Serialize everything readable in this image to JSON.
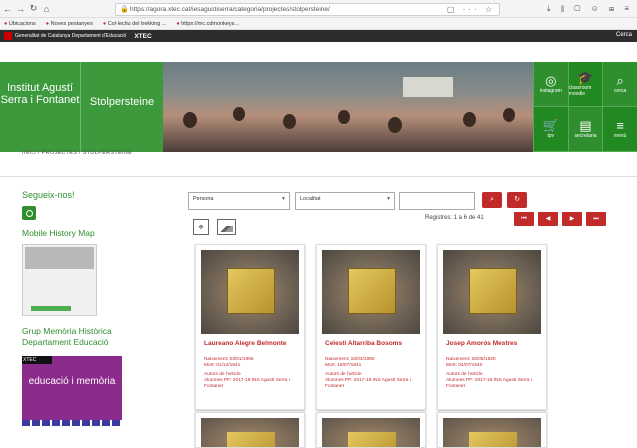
{
  "browser": {
    "url": "https://agora.xtec.cat/iesagustiserra/categoria/projectes/stolpersteine/",
    "bookmarks": [
      "Ubicacions",
      "Noves pestanyes",
      "Col·lectiu del trekking ...",
      "https://mc.cdmonkeys..."
    ]
  },
  "gencat": {
    "org": "Generalitat de Catalunya Departament d'Educació",
    "xtec": "XTEC",
    "cerca": "Cerca"
  },
  "header": {
    "institute": "Institut Agustí Serra i Fontanet",
    "project": "Stolpersteine",
    "tiles": [
      {
        "icon": "instagram-icon",
        "label": "instagram"
      },
      {
        "icon": "graduation-icon",
        "label": "classroom moodle"
      },
      {
        "icon": "search-icon",
        "label": "cerca"
      },
      {
        "icon": "cart-icon",
        "label": "tpv"
      },
      {
        "icon": "book-icon",
        "label": "secretaria"
      },
      {
        "icon": "menu-icon",
        "label": "menú"
      }
    ]
  },
  "breadcrumb": "INICI / PROJECTES / STOLPERSTEINE",
  "sidebar": {
    "follow": "Segueix-nos!",
    "mobile_map": "Mobile History Map",
    "grup": "Grup Memòria Històrica Departament Educació",
    "edu_text": "educació i memòria",
    "xtec_small": "XTEC"
  },
  "filters": {
    "persona": "Persona",
    "localitat": "Localitat",
    "search_value": ""
  },
  "pagination": {
    "registres": "Registres: 1 a 6 de 41"
  },
  "cards": [
    {
      "name": "Laureano Alegre Belmonte",
      "naixement": "Naixement: 03/01/1906",
      "mort": "Mort: 01/12/1941",
      "autors": "Autors de l'article",
      "alumnes": "Alumnes PF: 2017-18 INS Agustí Serra i Fontanet"
    },
    {
      "name": "Celestí Altarriba Bosoms",
      "naixement": "Naixement: 16/03/1890",
      "mort": "Mort: 18/07/1941",
      "autors": "Autors de l'article",
      "alumnes": "Alumnes PF: 2017-18 INS Agustí Serra i Fontanet"
    },
    {
      "name": "Josep Amorós Mestres",
      "naixement": "Naixement: 26/05/1920",
      "mort": "Mort: 04/07/1940",
      "autors": "Autors de l'article",
      "alumnes": "Alumnes PF: 2017-18 INS Agustí Serra i Fontanet"
    }
  ],
  "colors": {
    "green": "#3c9a3c",
    "red": "#c22a2a"
  }
}
